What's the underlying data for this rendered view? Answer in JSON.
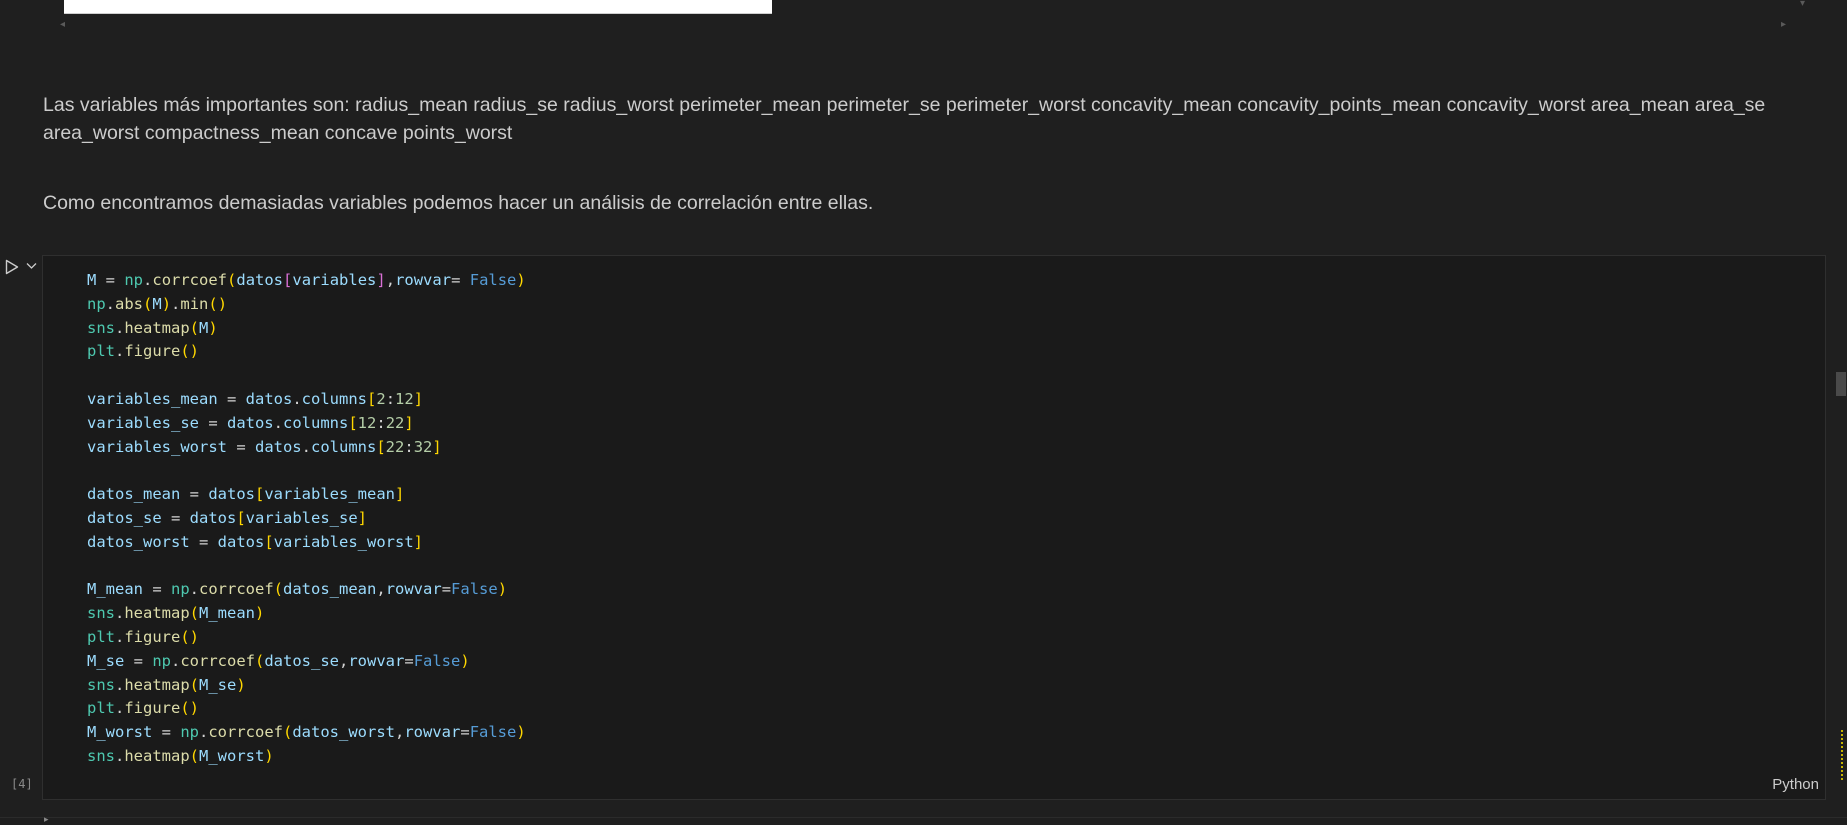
{
  "markdown": {
    "p1": "Las variables más importantes son: radius_mean radius_se radius_worst perimeter_mean perimeter_se perimeter_worst concavity_mean concavity_points_mean concavity_worst area_mean area_se area_worst compactness_mean concave points_worst",
    "p2": "Como encontramos demasiadas variables podemos hacer un análisis de correlación entre ellas."
  },
  "cell": {
    "execution_count": "[4]",
    "language": "Python",
    "code_lines": [
      [
        [
          "M",
          "var"
        ],
        [
          " = ",
          "op"
        ],
        [
          "np",
          "mod"
        ],
        [
          ".",
          "op"
        ],
        [
          "corrcoef",
          "fn"
        ],
        [
          "(",
          "b1"
        ],
        [
          "datos",
          "var"
        ],
        [
          "[",
          "b2"
        ],
        [
          "variables",
          "var"
        ],
        [
          "]",
          "b2"
        ],
        [
          ",",
          "op"
        ],
        [
          "rowvar",
          "var"
        ],
        [
          "= ",
          "op"
        ],
        [
          "False",
          "kw"
        ],
        [
          ")",
          "b1"
        ]
      ],
      [
        [
          "np",
          "mod"
        ],
        [
          ".",
          "op"
        ],
        [
          "abs",
          "fn"
        ],
        [
          "(",
          "b1"
        ],
        [
          "M",
          "var"
        ],
        [
          ")",
          "b1"
        ],
        [
          ".",
          "op"
        ],
        [
          "min",
          "fn"
        ],
        [
          "()",
          "b1"
        ]
      ],
      [
        [
          "sns",
          "mod"
        ],
        [
          ".",
          "op"
        ],
        [
          "heatmap",
          "fn"
        ],
        [
          "(",
          "b1"
        ],
        [
          "M",
          "var"
        ],
        [
          ")",
          "b1"
        ]
      ],
      [
        [
          "plt",
          "mod"
        ],
        [
          ".",
          "op"
        ],
        [
          "figure",
          "fn"
        ],
        [
          "()",
          "b1"
        ]
      ],
      [],
      [
        [
          "variables_mean",
          "var"
        ],
        [
          " = ",
          "op"
        ],
        [
          "datos",
          "var"
        ],
        [
          ".",
          "op"
        ],
        [
          "columns",
          "var"
        ],
        [
          "[",
          "b1"
        ],
        [
          "2",
          "num"
        ],
        [
          ":",
          "op"
        ],
        [
          "12",
          "num"
        ],
        [
          "]",
          "b1"
        ]
      ],
      [
        [
          "variables_se",
          "var"
        ],
        [
          " = ",
          "op"
        ],
        [
          "datos",
          "var"
        ],
        [
          ".",
          "op"
        ],
        [
          "columns",
          "var"
        ],
        [
          "[",
          "b1"
        ],
        [
          "12",
          "num"
        ],
        [
          ":",
          "op"
        ],
        [
          "22",
          "num"
        ],
        [
          "]",
          "b1"
        ]
      ],
      [
        [
          "variables_worst",
          "var"
        ],
        [
          " = ",
          "op"
        ],
        [
          "datos",
          "var"
        ],
        [
          ".",
          "op"
        ],
        [
          "columns",
          "var"
        ],
        [
          "[",
          "b1"
        ],
        [
          "22",
          "num"
        ],
        [
          ":",
          "op"
        ],
        [
          "32",
          "num"
        ],
        [
          "]",
          "b1"
        ]
      ],
      [],
      [
        [
          "datos_mean",
          "var"
        ],
        [
          " = ",
          "op"
        ],
        [
          "datos",
          "var"
        ],
        [
          "[",
          "b1"
        ],
        [
          "variables_mean",
          "var"
        ],
        [
          "]",
          "b1"
        ]
      ],
      [
        [
          "datos_se",
          "var"
        ],
        [
          " = ",
          "op"
        ],
        [
          "datos",
          "var"
        ],
        [
          "[",
          "b1"
        ],
        [
          "variables_se",
          "var"
        ],
        [
          "]",
          "b1"
        ]
      ],
      [
        [
          "datos_worst",
          "var"
        ],
        [
          " = ",
          "op"
        ],
        [
          "datos",
          "var"
        ],
        [
          "[",
          "b1"
        ],
        [
          "variables_worst",
          "var"
        ],
        [
          "]",
          "b1"
        ]
      ],
      [],
      [
        [
          "M_mean",
          "var"
        ],
        [
          " = ",
          "op"
        ],
        [
          "np",
          "mod"
        ],
        [
          ".",
          "op"
        ],
        [
          "corrcoef",
          "fn"
        ],
        [
          "(",
          "b1"
        ],
        [
          "datos_mean",
          "var"
        ],
        [
          ",",
          "op"
        ],
        [
          "rowvar",
          "var"
        ],
        [
          "=",
          "op"
        ],
        [
          "False",
          "kw"
        ],
        [
          ")",
          "b1"
        ]
      ],
      [
        [
          "sns",
          "mod"
        ],
        [
          ".",
          "op"
        ],
        [
          "heatmap",
          "fn"
        ],
        [
          "(",
          "b1"
        ],
        [
          "M_mean",
          "var"
        ],
        [
          ")",
          "b1"
        ]
      ],
      [
        [
          "plt",
          "mod"
        ],
        [
          ".",
          "op"
        ],
        [
          "figure",
          "fn"
        ],
        [
          "()",
          "b1"
        ]
      ],
      [
        [
          "M_se",
          "var"
        ],
        [
          " = ",
          "op"
        ],
        [
          "np",
          "mod"
        ],
        [
          ".",
          "op"
        ],
        [
          "corrcoef",
          "fn"
        ],
        [
          "(",
          "b1"
        ],
        [
          "datos_se",
          "var"
        ],
        [
          ",",
          "op"
        ],
        [
          "rowvar",
          "var"
        ],
        [
          "=",
          "op"
        ],
        [
          "False",
          "kw"
        ],
        [
          ")",
          "b1"
        ]
      ],
      [
        [
          "sns",
          "mod"
        ],
        [
          ".",
          "op"
        ],
        [
          "heatmap",
          "fn"
        ],
        [
          "(",
          "b1"
        ],
        [
          "M_se",
          "var"
        ],
        [
          ")",
          "b1"
        ]
      ],
      [
        [
          "plt",
          "mod"
        ],
        [
          ".",
          "op"
        ],
        [
          "figure",
          "fn"
        ],
        [
          "()",
          "b1"
        ]
      ],
      [
        [
          "M_worst",
          "var"
        ],
        [
          " = ",
          "op"
        ],
        [
          "np",
          "mod"
        ],
        [
          ".",
          "op"
        ],
        [
          "corrcoef",
          "fn"
        ],
        [
          "(",
          "b1"
        ],
        [
          "datos_worst",
          "var"
        ],
        [
          ",",
          "op"
        ],
        [
          "rowvar",
          "var"
        ],
        [
          "=",
          "op"
        ],
        [
          "False",
          "kw"
        ],
        [
          ")",
          "b1"
        ]
      ],
      [
        [
          "sns",
          "mod"
        ],
        [
          ".",
          "op"
        ],
        [
          "heatmap",
          "fn"
        ],
        [
          "(",
          "b1"
        ],
        [
          "M_worst",
          "var"
        ],
        [
          ")",
          "b1"
        ]
      ]
    ]
  },
  "icons": {
    "run": "run-cell-icon",
    "chevron": "chevron-down-icon"
  }
}
